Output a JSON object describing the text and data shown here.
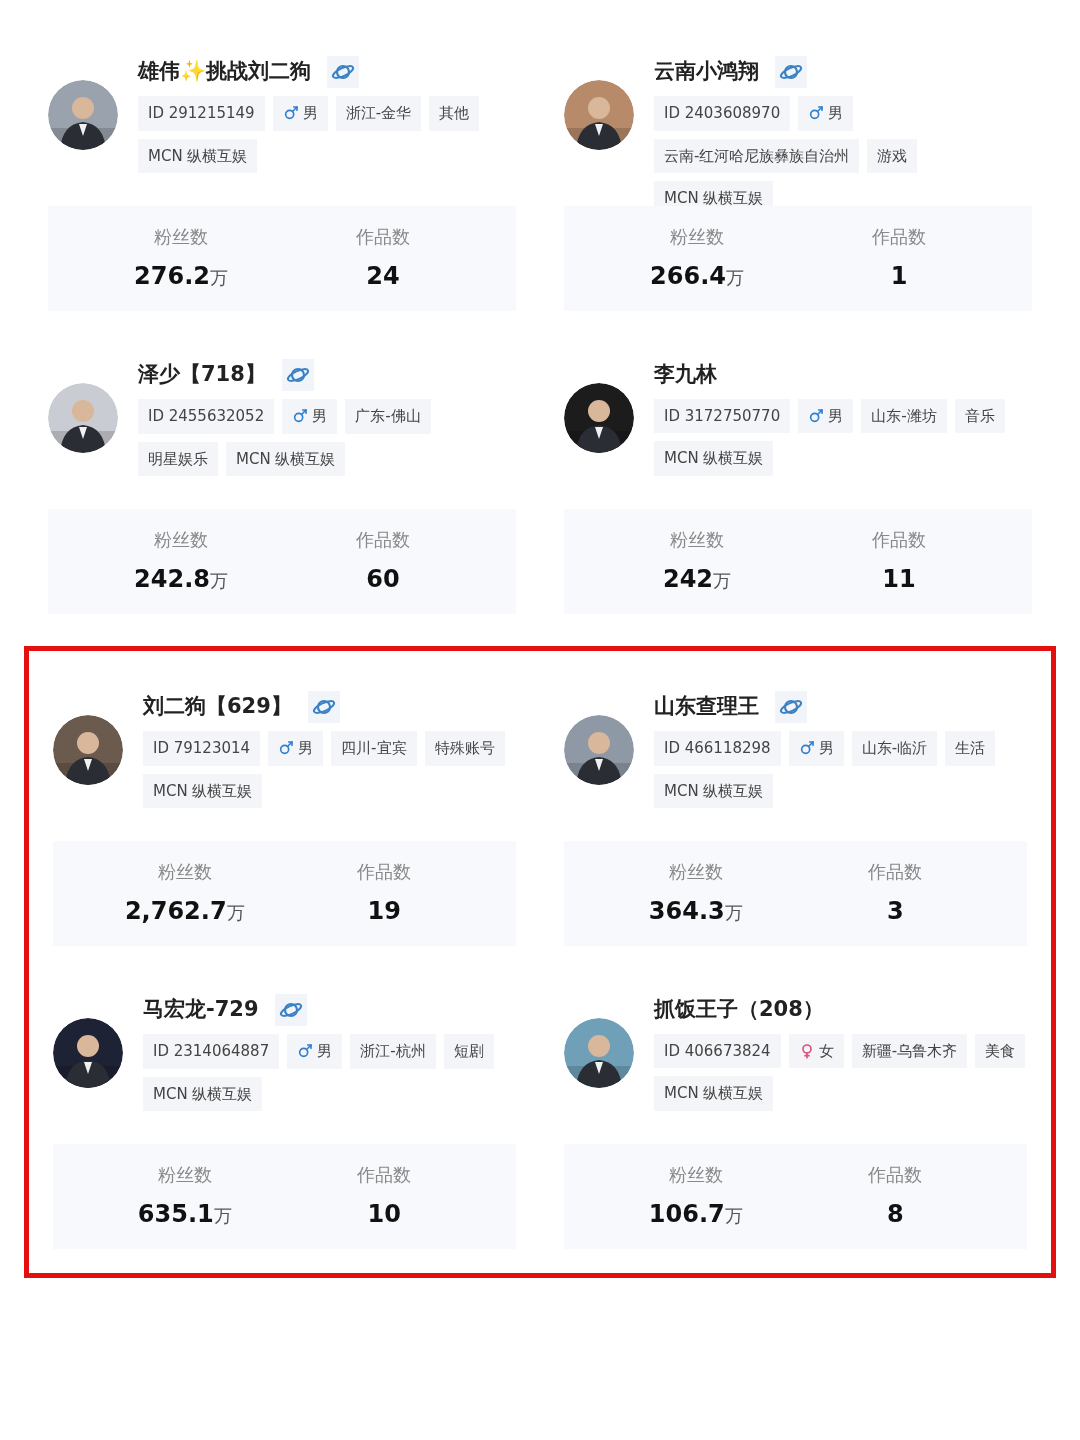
{
  "sections": [
    {
      "highlighted": false,
      "cards": [
        {
          "name": "雄伟✨挑战刘二狗",
          "verified": true,
          "tags": [
            {
              "kind": "id",
              "text": "ID 291215149"
            },
            {
              "kind": "gender",
              "female": false,
              "text": "男"
            },
            {
              "kind": "plain",
              "text": "浙江-金华"
            },
            {
              "kind": "plain",
              "text": "其他"
            },
            {
              "kind": "plain",
              "text": "MCN 纵横互娱"
            }
          ],
          "fans": {
            "label": "粉丝数",
            "value": "276.2",
            "unit": "万"
          },
          "works": {
            "label": "作品数",
            "value": "24"
          }
        },
        {
          "name": "云南小鸿翔",
          "verified": true,
          "tags": [
            {
              "kind": "id",
              "text": "ID 2403608970"
            },
            {
              "kind": "gender",
              "female": false,
              "text": "男"
            },
            {
              "kind": "plain",
              "text": "云南-红河哈尼族彝族自治州"
            },
            {
              "kind": "plain",
              "text": "游戏"
            },
            {
              "kind": "plain",
              "text": "MCN 纵横互娱"
            }
          ],
          "fans": {
            "label": "粉丝数",
            "value": "266.4",
            "unit": "万"
          },
          "works": {
            "label": "作品数",
            "value": "1"
          }
        },
        {
          "name": "泽少【718】",
          "verified": true,
          "tags": [
            {
              "kind": "id",
              "text": "ID 2455632052"
            },
            {
              "kind": "gender",
              "female": false,
              "text": "男"
            },
            {
              "kind": "plain",
              "text": "广东-佛山"
            },
            {
              "kind": "plain",
              "text": "明星娱乐"
            },
            {
              "kind": "plain",
              "text": "MCN 纵横互娱"
            }
          ],
          "fans": {
            "label": "粉丝数",
            "value": "242.8",
            "unit": "万"
          },
          "works": {
            "label": "作品数",
            "value": "60"
          }
        },
        {
          "name": "李九林",
          "verified": false,
          "tags": [
            {
              "kind": "id",
              "text": "ID 3172750770"
            },
            {
              "kind": "gender",
              "female": false,
              "text": "男"
            },
            {
              "kind": "plain",
              "text": "山东-潍坊"
            },
            {
              "kind": "plain",
              "text": "音乐"
            },
            {
              "kind": "plain",
              "text": "MCN 纵横互娱"
            }
          ],
          "fans": {
            "label": "粉丝数",
            "value": "242",
            "unit": "万"
          },
          "works": {
            "label": "作品数",
            "value": "11"
          }
        }
      ]
    },
    {
      "highlighted": true,
      "cards": [
        {
          "name": "刘二狗【629】",
          "verified": true,
          "tags": [
            {
              "kind": "id",
              "text": "ID 79123014"
            },
            {
              "kind": "gender",
              "female": false,
              "text": "男"
            },
            {
              "kind": "plain",
              "text": "四川-宜宾"
            },
            {
              "kind": "plain",
              "text": "特殊账号"
            },
            {
              "kind": "plain",
              "text": "MCN 纵横互娱"
            }
          ],
          "fans": {
            "label": "粉丝数",
            "value": "2,762.7",
            "unit": "万"
          },
          "works": {
            "label": "作品数",
            "value": "19"
          }
        },
        {
          "name": "山东查理王",
          "verified": true,
          "tags": [
            {
              "kind": "id",
              "text": "ID 466118298"
            },
            {
              "kind": "gender",
              "female": false,
              "text": "男"
            },
            {
              "kind": "plain",
              "text": "山东-临沂"
            },
            {
              "kind": "plain",
              "text": "生活"
            },
            {
              "kind": "plain",
              "text": "MCN 纵横互娱"
            }
          ],
          "fans": {
            "label": "粉丝数",
            "value": "364.3",
            "unit": "万"
          },
          "works": {
            "label": "作品数",
            "value": "3"
          }
        },
        {
          "name": "马宏龙-729",
          "verified": true,
          "tags": [
            {
              "kind": "id",
              "text": "ID 2314064887"
            },
            {
              "kind": "gender",
              "female": false,
              "text": "男"
            },
            {
              "kind": "plain",
              "text": "浙江-杭州"
            },
            {
              "kind": "plain",
              "text": "短剧"
            },
            {
              "kind": "plain",
              "text": "MCN 纵横互娱"
            }
          ],
          "fans": {
            "label": "粉丝数",
            "value": "635.1",
            "unit": "万"
          },
          "works": {
            "label": "作品数",
            "value": "10"
          }
        },
        {
          "name": "抓饭王子（208）",
          "verified": false,
          "tags": [
            {
              "kind": "id",
              "text": "ID 406673824"
            },
            {
              "kind": "gender",
              "female": true,
              "text": "女"
            },
            {
              "kind": "plain",
              "text": "新疆-乌鲁木齐"
            },
            {
              "kind": "plain",
              "text": "美食"
            },
            {
              "kind": "plain",
              "text": "MCN 纵横互娱"
            }
          ],
          "fans": {
            "label": "粉丝数",
            "value": "106.7",
            "unit": "万"
          },
          "works": {
            "label": "作品数",
            "value": "8"
          }
        }
      ]
    }
  ]
}
